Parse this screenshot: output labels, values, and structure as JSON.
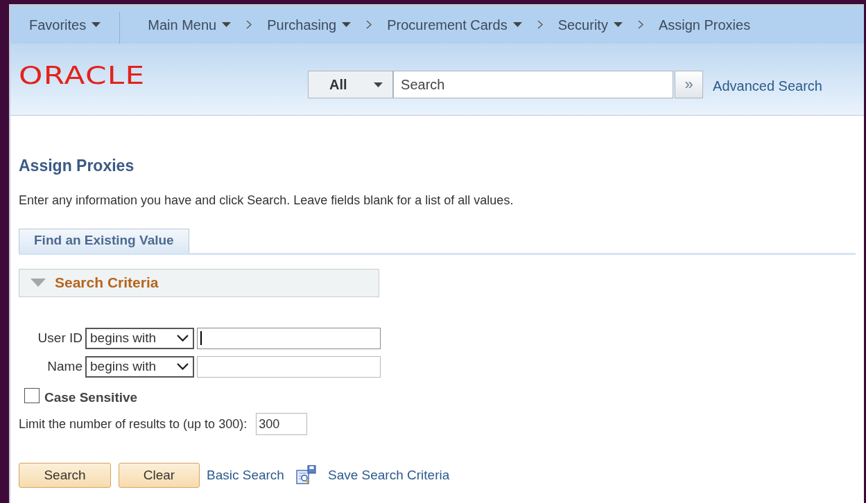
{
  "nav": [
    {
      "label": "Favorites",
      "menu": true
    },
    {
      "label": "Main Menu",
      "menu": true
    },
    {
      "label": "Purchasing",
      "menu": true
    },
    {
      "label": "Procurement Cards",
      "menu": true
    },
    {
      "label": "Security",
      "menu": true
    },
    {
      "label": "Assign Proxies",
      "menu": false
    }
  ],
  "logo": "ORACLE",
  "search": {
    "scope": "All",
    "placeholder": "Search",
    "go": "»",
    "advanced": "Advanced Search"
  },
  "page_title": "Assign Proxies",
  "instructions": "Enter any information you have and click Search. Leave fields blank for a list of all values.",
  "tabs": [
    {
      "label": "Find an Existing Value",
      "selected": true
    }
  ],
  "section": {
    "title": "Search Criteria",
    "expanded": true
  },
  "fields": [
    {
      "label": "User ID",
      "operator": "begins with",
      "focused": true
    },
    {
      "label": "Name",
      "operator": "begins with",
      "focused": false
    }
  ],
  "case_sensitive": {
    "label": "Case Sensitive",
    "checked": false
  },
  "limit": {
    "label": "Limit the number of results to (up to 300):",
    "value": "300"
  },
  "buttons": [
    "Search",
    "Clear"
  ],
  "links": [
    {
      "label": "Basic Search",
      "kind": "link"
    },
    {
      "label": "Save Search Criteria",
      "kind": "save"
    }
  ]
}
